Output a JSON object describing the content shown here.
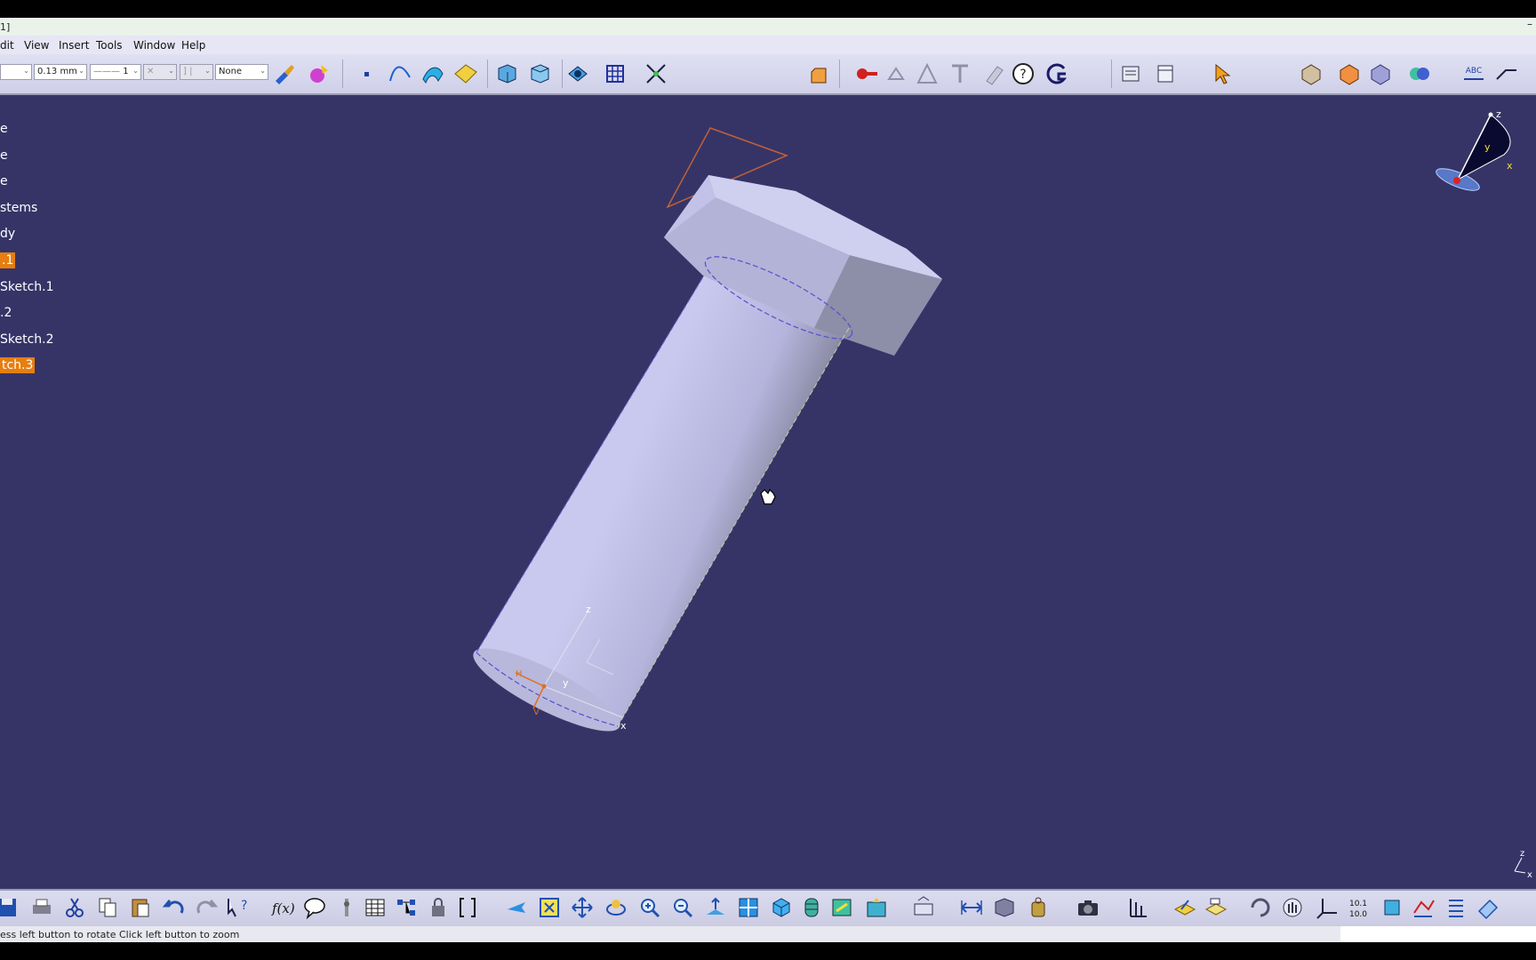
{
  "window": {
    "title": "1]"
  },
  "menu": [
    "dit",
    "View",
    "Insert",
    "Tools",
    "Window",
    "Help"
  ],
  "toolbar": {
    "thickness": "0.13 mm",
    "line_type": "1",
    "layer": "None"
  },
  "tree": [
    {
      "label": "e",
      "selected": false
    },
    {
      "label": "e",
      "selected": false
    },
    {
      "label": "e",
      "selected": false
    },
    {
      "label": "stems",
      "selected": false
    },
    {
      "label": "dy",
      "selected": false
    },
    {
      "label": ".1",
      "selected": true
    },
    {
      "label": "Sketch.1",
      "selected": false
    },
    {
      "label": ".2",
      "selected": false
    },
    {
      "label": "Sketch.2",
      "selected": false
    },
    {
      "label": "tch.3",
      "selected": true
    }
  ],
  "compass": {
    "z": "z",
    "y": "y",
    "x": "x"
  },
  "local_axes": {
    "z": "z",
    "y": "y",
    "x": "x",
    "h": "H",
    "v": "V"
  },
  "status": {
    "message": "ess left button to rotate  Click left button to zoom"
  },
  "colors": {
    "viewport": "#363467",
    "selection": "#e67e10",
    "toolbar": "#d8d8ee",
    "part_light": "#c8c8ee",
    "part_shadow": "#7a7a96"
  }
}
